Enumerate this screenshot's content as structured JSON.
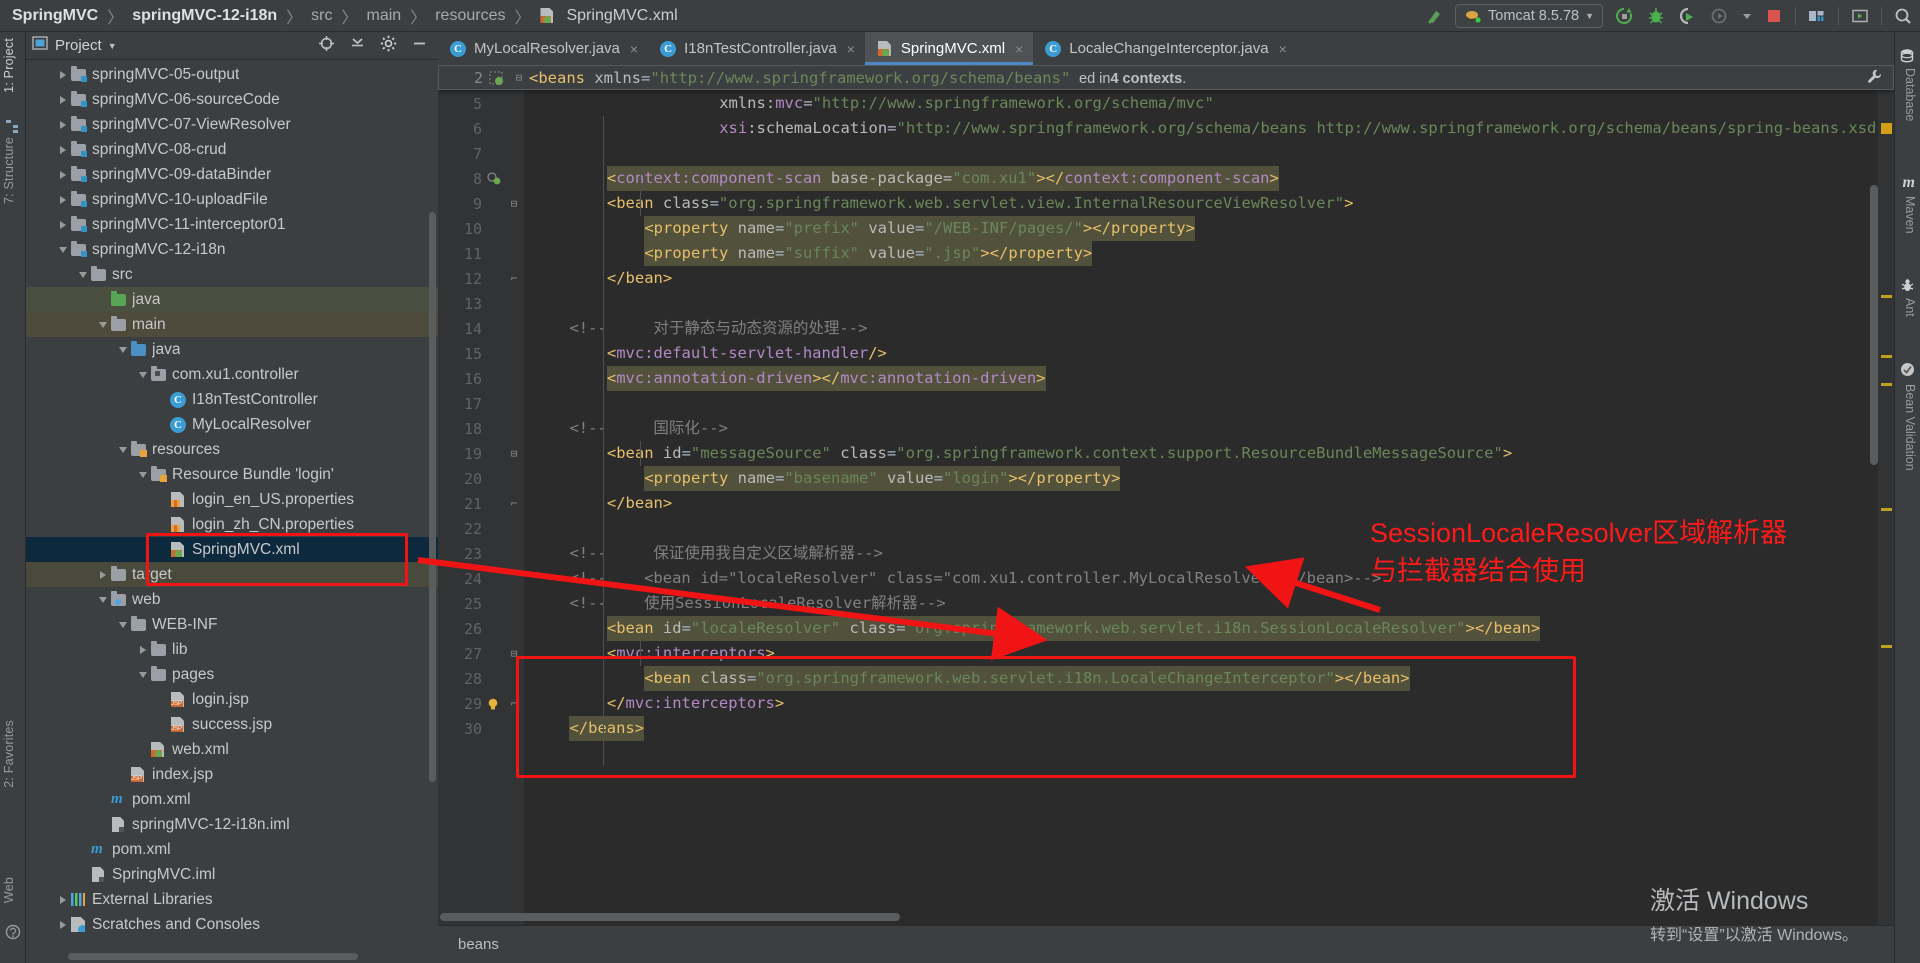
{
  "breadcrumb": {
    "items": [
      "SpringMVC",
      "springMVC-12-i18n",
      "src",
      "main",
      "resources"
    ],
    "file": "SpringMVC.xml",
    "separator": "〉"
  },
  "toolbar": {
    "makeproject_icon": "hammer-icon",
    "run_config": "Tomcat 8.5.78",
    "run_config_caret": "▼",
    "icons": [
      "rerun-icon",
      "debug-icon",
      "run-with-coverage-icon",
      "profiler-icon",
      "stop-icon",
      "project-structure-icon",
      "run-anything-icon",
      "search-everywhere-icon"
    ]
  },
  "left_tool_strip": [
    {
      "label": "1: Project",
      "active": true
    },
    {
      "label": "7: Structure",
      "active": false
    },
    {
      "label": "2: Favorites",
      "active": false
    },
    {
      "label": "Web",
      "active": false
    }
  ],
  "right_tool_strip": [
    {
      "label": "Database"
    },
    {
      "label": "Maven"
    },
    {
      "label": "Ant"
    },
    {
      "label": "Bean Validation"
    }
  ],
  "project_panel": {
    "title": "Project",
    "caret": "▼",
    "header_icons": [
      "locate-icon",
      "collapse-all-icon",
      "settings-gear-icon",
      "hide-icon"
    ],
    "tree": [
      {
        "depth": 1,
        "arrow": "right",
        "icon": "module-folder",
        "label": "springMVC-05-output",
        "state": "partial"
      },
      {
        "depth": 1,
        "arrow": "right",
        "icon": "module-folder",
        "label": "springMVC-06-sourceCode"
      },
      {
        "depth": 1,
        "arrow": "right",
        "icon": "module-folder",
        "label": "springMVC-07-ViewResolver"
      },
      {
        "depth": 1,
        "arrow": "right",
        "icon": "module-folder",
        "label": "springMVC-08-crud"
      },
      {
        "depth": 1,
        "arrow": "right",
        "icon": "module-folder",
        "label": "springMVC-09-dataBinder"
      },
      {
        "depth": 1,
        "arrow": "right",
        "icon": "module-folder",
        "label": "springMVC-10-uploadFile"
      },
      {
        "depth": 1,
        "arrow": "right",
        "icon": "module-folder",
        "label": "springMVC-11-interceptor01"
      },
      {
        "depth": 1,
        "arrow": "down",
        "icon": "module-folder",
        "label": "springMVC-12-i18n"
      },
      {
        "depth": 2,
        "arrow": "down",
        "icon": "folder",
        "label": "src"
      },
      {
        "depth": 3,
        "arrow": "none",
        "icon": "source-folder",
        "label": "java",
        "row": "sel-green"
      },
      {
        "depth": 3,
        "arrow": "down",
        "icon": "folder",
        "label": "main",
        "row": "hl-olive"
      },
      {
        "depth": 4,
        "arrow": "down",
        "icon": "source-folder-blue",
        "label": "java"
      },
      {
        "depth": 5,
        "arrow": "down",
        "icon": "package",
        "label": "com.xu1.controller"
      },
      {
        "depth": 6,
        "arrow": "none",
        "icon": "class",
        "label": "I18nTestController"
      },
      {
        "depth": 6,
        "arrow": "none",
        "icon": "class",
        "label": "MyLocalResolver"
      },
      {
        "depth": 4,
        "arrow": "down",
        "icon": "resources-folder",
        "label": "resources"
      },
      {
        "depth": 5,
        "arrow": "down",
        "icon": "resource-bundle",
        "label": "Resource Bundle 'login'"
      },
      {
        "depth": 6,
        "arrow": "none",
        "icon": "properties",
        "label": "login_en_US.properties"
      },
      {
        "depth": 6,
        "arrow": "none",
        "icon": "properties",
        "label": "login_zh_CN.properties"
      },
      {
        "depth": 6,
        "arrow": "none",
        "icon": "spring-xml",
        "label": "SpringMVC.xml",
        "row": "sel-blue",
        "boxed": true
      },
      {
        "depth": 3,
        "arrow": "right",
        "icon": "folder",
        "label": "target",
        "row": "hl-olive2"
      },
      {
        "depth": 3,
        "arrow": "down",
        "icon": "web-folder",
        "label": "web"
      },
      {
        "depth": 4,
        "arrow": "down",
        "icon": "folder",
        "label": "WEB-INF"
      },
      {
        "depth": 5,
        "arrow": "right",
        "icon": "folder",
        "label": "lib"
      },
      {
        "depth": 5,
        "arrow": "down",
        "icon": "folder",
        "label": "pages"
      },
      {
        "depth": 6,
        "arrow": "none",
        "icon": "jsp",
        "label": "login.jsp"
      },
      {
        "depth": 6,
        "arrow": "none",
        "icon": "jsp",
        "label": "success.jsp"
      },
      {
        "depth": 5,
        "arrow": "none",
        "icon": "web-xml",
        "label": "web.xml"
      },
      {
        "depth": 4,
        "arrow": "none",
        "icon": "jsp",
        "label": "index.jsp"
      },
      {
        "depth": 3,
        "arrow": "none",
        "icon": "maven",
        "label": "pom.xml"
      },
      {
        "depth": 3,
        "arrow": "none",
        "icon": "iml",
        "label": "springMVC-12-i18n.iml"
      },
      {
        "depth": 2,
        "arrow": "none",
        "icon": "maven",
        "label": "pom.xml"
      },
      {
        "depth": 2,
        "arrow": "none",
        "icon": "iml",
        "label": "SpringMVC.iml"
      },
      {
        "depth": 1,
        "arrow": "right",
        "icon": "libraries",
        "label": "External Libraries"
      },
      {
        "depth": 1,
        "arrow": "right",
        "icon": "scratches",
        "label": "Scratches and Consoles"
      }
    ]
  },
  "editor": {
    "tabs": [
      {
        "label": "MyLocalResolver.java",
        "icon": "java-class-icon",
        "active": false,
        "close": "×"
      },
      {
        "label": "I18nTestController.java",
        "icon": "java-class-icon",
        "active": false,
        "close": "×"
      },
      {
        "label": "SpringMVC.xml",
        "icon": "spring-xml-icon",
        "active": true,
        "close": "×"
      },
      {
        "label": "LocaleChangeInterceptor.java",
        "icon": "java-class-icon",
        "active": false,
        "close": "×"
      }
    ],
    "sticky": {
      "number": "2",
      "code": "<beans xmlns=\"http://www.springframework.org/schema/beans\"",
      "warning_prefix": "ed in ",
      "warning_bold": "4 contexts",
      "warning_suffix": "."
    },
    "status_text": "beans",
    "lines": [
      {
        "n": 5,
        "indent": 5,
        "fold": "",
        "tokens": [
          {
            "t": "xmlns:",
            "c": "at"
          },
          {
            "t": "mvc",
            "c": "ns"
          },
          {
            "t": "=",
            "c": "eq"
          },
          {
            "t": "\"http://www.springframework.org/schema/mvc\"",
            "c": "av"
          }
        ]
      },
      {
        "n": 6,
        "indent": 5,
        "fold": "",
        "tokens": [
          {
            "t": "xsi",
            "c": "ns"
          },
          {
            "t": ":schemaLocation",
            "c": "at"
          },
          {
            "t": "=",
            "c": "eq"
          },
          {
            "t": "\"http://www.springframework.org/schema/beans http://www.springframework.org/schema/beans/spring-beans.xsd http:/",
            "c": "av"
          }
        ]
      },
      {
        "n": 7,
        "indent": 0,
        "fold": "",
        "tokens": []
      },
      {
        "n": 8,
        "indent": 2,
        "fold": "",
        "hl": true,
        "anno": "bean-gutter-icon",
        "tokens": [
          {
            "t": "<",
            "c": "tg"
          },
          {
            "t": "context:component-scan",
            "c": "ns"
          },
          {
            "t": " base-package=",
            "c": "at"
          },
          {
            "t": "\"com.xu1\"",
            "c": "av"
          },
          {
            "t": "></",
            "c": "tg"
          },
          {
            "t": "context:component-scan",
            "c": "ns"
          },
          {
            "t": ">",
            "c": "tg"
          }
        ]
      },
      {
        "n": 9,
        "indent": 2,
        "fold": "open",
        "tokens": [
          {
            "t": "<",
            "c": "tg"
          },
          {
            "t": "bean ",
            "c": "tgn"
          },
          {
            "t": "class",
            "c": "at"
          },
          {
            "t": "=",
            "c": "eq"
          },
          {
            "t": "\"org.springframework.web.servlet.view.InternalResourceViewResolver\"",
            "c": "av"
          },
          {
            "t": ">",
            "c": "tg"
          }
        ]
      },
      {
        "n": 10,
        "indent": 3,
        "fold": "",
        "hl": true,
        "tokens": [
          {
            "t": "<",
            "c": "tg"
          },
          {
            "t": "property ",
            "c": "tgn"
          },
          {
            "t": "name",
            "c": "at"
          },
          {
            "t": "=",
            "c": "eq"
          },
          {
            "t": "\"prefix\"",
            "c": "av"
          },
          {
            "t": " value",
            "c": "at"
          },
          {
            "t": "=",
            "c": "eq"
          },
          {
            "t": "\"/WEB-INF/pages/\"",
            "c": "av"
          },
          {
            "t": "></",
            "c": "tg"
          },
          {
            "t": "property",
            "c": "tgn"
          },
          {
            "t": ">",
            "c": "tg"
          }
        ]
      },
      {
        "n": 11,
        "indent": 3,
        "fold": "",
        "hl": true,
        "tokens": [
          {
            "t": "<",
            "c": "tg"
          },
          {
            "t": "property ",
            "c": "tgn"
          },
          {
            "t": "name",
            "c": "at"
          },
          {
            "t": "=",
            "c": "eq"
          },
          {
            "t": "\"suffix\"",
            "c": "av"
          },
          {
            "t": " value",
            "c": "at"
          },
          {
            "t": "=",
            "c": "eq"
          },
          {
            "t": "\".jsp\"",
            "c": "av"
          },
          {
            "t": "></",
            "c": "tg"
          },
          {
            "t": "property",
            "c": "tgn"
          },
          {
            "t": ">",
            "c": "tg"
          }
        ]
      },
      {
        "n": 12,
        "indent": 2,
        "fold": "close",
        "tokens": [
          {
            "t": "</",
            "c": "tg"
          },
          {
            "t": "bean",
            "c": "tgn"
          },
          {
            "t": ">",
            "c": "tg"
          }
        ]
      },
      {
        "n": 13,
        "indent": 0,
        "fold": "",
        "tokens": []
      },
      {
        "n": 14,
        "indent": 1,
        "fold": "",
        "tokens": [
          {
            "t": "<!--     对于静态与动态资源的处理-->",
            "c": "cm"
          }
        ]
      },
      {
        "n": 15,
        "indent": 2,
        "fold": "",
        "tokens": [
          {
            "t": "<",
            "c": "tg"
          },
          {
            "t": "mvc:default-servlet-handler",
            "c": "ns"
          },
          {
            "t": "/>",
            "c": "tg"
          }
        ]
      },
      {
        "n": 16,
        "indent": 2,
        "fold": "",
        "hl": true,
        "tokens": [
          {
            "t": "<",
            "c": "tg"
          },
          {
            "t": "mvc:annotation-driven",
            "c": "ns"
          },
          {
            "t": "></",
            "c": "tg"
          },
          {
            "t": "mvc:annotation-driven",
            "c": "ns"
          },
          {
            "t": ">",
            "c": "tg"
          }
        ]
      },
      {
        "n": 17,
        "indent": 0,
        "fold": "",
        "tokens": []
      },
      {
        "n": 18,
        "indent": 1,
        "fold": "",
        "tokens": [
          {
            "t": "<!--     国际化-->",
            "c": "cm"
          }
        ]
      },
      {
        "n": 19,
        "indent": 2,
        "fold": "open",
        "tokens": [
          {
            "t": "<",
            "c": "tg"
          },
          {
            "t": "bean ",
            "c": "tgn"
          },
          {
            "t": "id",
            "c": "at"
          },
          {
            "t": "=",
            "c": "eq"
          },
          {
            "t": "\"messageSource\"",
            "c": "av"
          },
          {
            "t": " class",
            "c": "at"
          },
          {
            "t": "=",
            "c": "eq"
          },
          {
            "t": "\"org.springframework.context.support.ResourceBundleMessageSource\"",
            "c": "av"
          },
          {
            "t": ">",
            "c": "tg"
          }
        ]
      },
      {
        "n": 20,
        "indent": 3,
        "fold": "",
        "hl": true,
        "tokens": [
          {
            "t": "<",
            "c": "tg"
          },
          {
            "t": "property ",
            "c": "tgn"
          },
          {
            "t": "name",
            "c": "at"
          },
          {
            "t": "=",
            "c": "eq"
          },
          {
            "t": "\"basename\"",
            "c": "av"
          },
          {
            "t": " value",
            "c": "at"
          },
          {
            "t": "=",
            "c": "eq"
          },
          {
            "t": "\"login\"",
            "c": "av"
          },
          {
            "t": "></",
            "c": "tg"
          },
          {
            "t": "property",
            "c": "tgn"
          },
          {
            "t": ">",
            "c": "tg"
          }
        ]
      },
      {
        "n": 21,
        "indent": 2,
        "fold": "close",
        "tokens": [
          {
            "t": "</",
            "c": "tg"
          },
          {
            "t": "bean",
            "c": "tgn"
          },
          {
            "t": ">",
            "c": "tg"
          }
        ]
      },
      {
        "n": 22,
        "indent": 0,
        "fold": "",
        "tokens": []
      },
      {
        "n": 23,
        "indent": 1,
        "fold": "",
        "tokens": [
          {
            "t": "<!--     保证使用我自定义区域解析器-->",
            "c": "cm"
          }
        ]
      },
      {
        "n": 24,
        "indent": 1,
        "fold": "",
        "tokens": [
          {
            "t": "<!--    <bean id=\"localeResolver\" class=\"com.xu1.controller.MyLocalResolver\"></bean>-->",
            "c": "cm"
          }
        ]
      },
      {
        "n": 25,
        "indent": 1,
        "fold": "",
        "tokens": [
          {
            "t": "<!--    使用SessionLocaleResolver解析器-->",
            "c": "cm"
          }
        ]
      },
      {
        "n": 26,
        "indent": 2,
        "fold": "",
        "hl": true,
        "tokens": [
          {
            "t": "<",
            "c": "tg"
          },
          {
            "t": "bean ",
            "c": "tgn"
          },
          {
            "t": "id",
            "c": "at"
          },
          {
            "t": "=",
            "c": "eq"
          },
          {
            "t": "\"localeResolver\"",
            "c": "av"
          },
          {
            "t": " class",
            "c": "at"
          },
          {
            "t": "=",
            "c": "eq"
          },
          {
            "t": "\"org.springframework.web.servlet.i18n.SessionLocaleResolver\"",
            "c": "av"
          },
          {
            "t": "></",
            "c": "tg"
          },
          {
            "t": "bean",
            "c": "tgn"
          },
          {
            "t": ">",
            "c": "tg"
          }
        ]
      },
      {
        "n": 27,
        "indent": 2,
        "fold": "open",
        "tokens": [
          {
            "t": "<",
            "c": "tg"
          },
          {
            "t": "mvc:interceptors",
            "c": "ns"
          },
          {
            "t": ">",
            "c": "tg"
          }
        ]
      },
      {
        "n": 28,
        "indent": 3,
        "fold": "",
        "hl": true,
        "tokens": [
          {
            "t": "<",
            "c": "tg"
          },
          {
            "t": "bean ",
            "c": "tgn"
          },
          {
            "t": "class",
            "c": "at"
          },
          {
            "t": "=",
            "c": "eq"
          },
          {
            "t": "\"org.springframework.web.servlet.i18n.LocaleChangeInterceptor\"",
            "c": "av"
          },
          {
            "t": "></",
            "c": "tg"
          },
          {
            "t": "bean",
            "c": "tgn"
          },
          {
            "t": ">",
            "c": "tg"
          }
        ]
      },
      {
        "n": 29,
        "indent": 2,
        "fold": "close",
        "anno": "bulb-icon",
        "tokens": [
          {
            "t": "</",
            "c": "tg"
          },
          {
            "t": "mvc:interceptors",
            "c": "ns"
          },
          {
            "t": ">",
            "c": "tg"
          }
        ]
      },
      {
        "n": 30,
        "indent": 1,
        "fold": "",
        "hl": true,
        "tokens": [
          {
            "t": "</",
            "c": "tg"
          },
          {
            "t": "beans",
            "c": "tgn"
          },
          {
            "t": ">",
            "c": "tg"
          }
        ]
      }
    ]
  },
  "annotations": {
    "red_note_line1": "SessionLocaleResolver区域解析器",
    "red_note_line2": "与拦截器结合使用",
    "color": "#ff1a1a"
  },
  "watermark": {
    "line1": "激活 Windows",
    "line2": "转到“设置”以激活 Windows。"
  }
}
